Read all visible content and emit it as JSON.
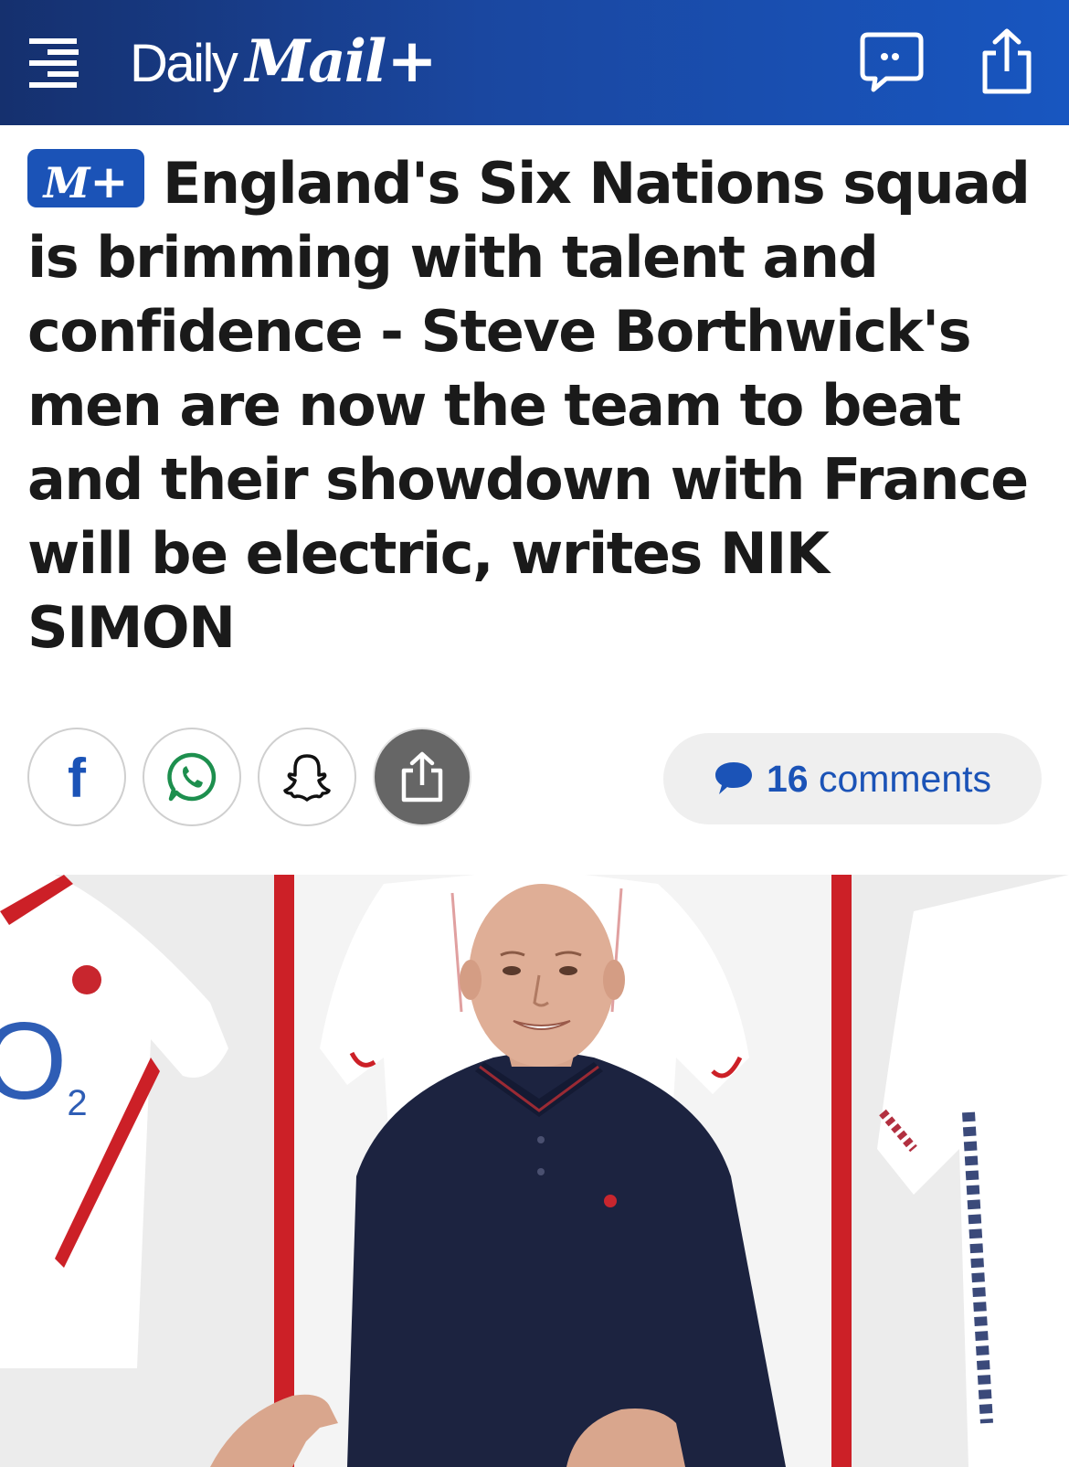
{
  "header": {
    "brand_daily": "Daily",
    "brand_mail": "Mail",
    "brand_plus": "+",
    "icons": [
      "menu-icon",
      "chat-bubble-icon",
      "share-icon"
    ],
    "color": "#1a47a0"
  },
  "article": {
    "badge_m": "M",
    "badge_plus": "+",
    "headline": "England's Six Nations squad is brimming with talent and confidence - Steve Borthwick's men are now the team to beat and their showdown with France will be electric, writes NIK SIMON"
  },
  "share": {
    "facebook": "f",
    "buttons": [
      "facebook-icon",
      "whatsapp-icon",
      "snapchat-icon",
      "share-icon"
    ],
    "comments_count": "16",
    "comments_label": " comments",
    "accent": "#1b53b7"
  },
  "photo": {
    "shirt_sponsor": "O",
    "shirt_sponsor_sub": "2",
    "icons": [
      "chevron-right-icon"
    ]
  }
}
